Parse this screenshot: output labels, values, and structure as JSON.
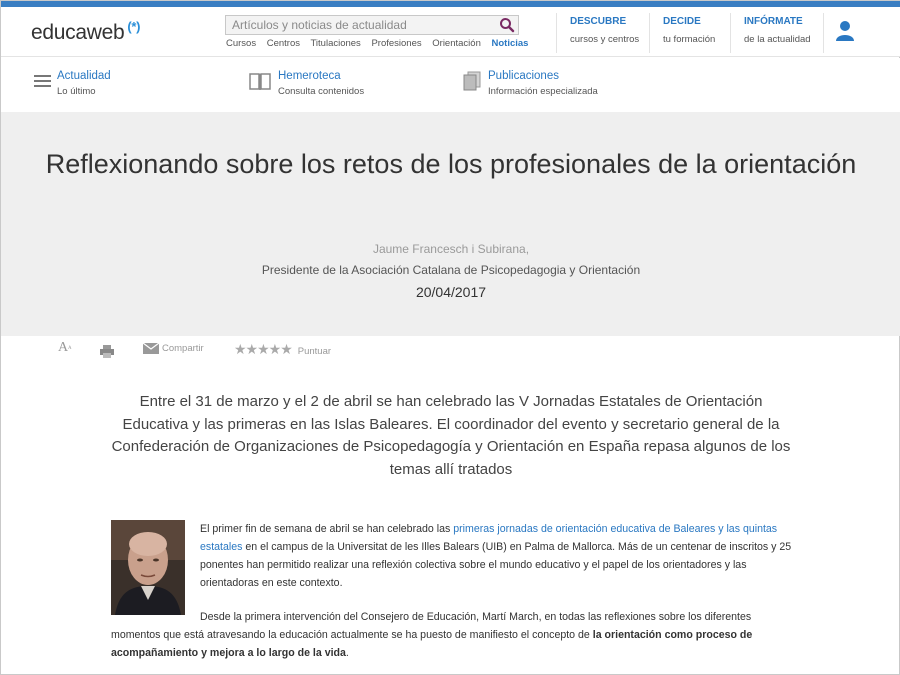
{
  "header": {
    "logo_text": "educaweb",
    "logo_mark": "(*)",
    "search_placeholder": "Artículos y noticias de actualidad",
    "top_links": [
      "Cursos",
      "Centros",
      "Titulaciones",
      "Profesiones",
      "Orientación",
      "Noticias"
    ],
    "active_link": "Noticias",
    "nav": [
      {
        "title": "DESCUBRE",
        "subtitle": "cursos y centros"
      },
      {
        "title": "DECIDE",
        "subtitle": "tu formación"
      },
      {
        "title": "INFÓRMATE",
        "subtitle": "de la actualidad"
      }
    ],
    "user_icon": "user-icon"
  },
  "subnav": [
    {
      "icon": "list-icon",
      "title": "Actualidad",
      "subtitle": "Lo último"
    },
    {
      "icon": "book-icon",
      "title": "Hemeroteca",
      "subtitle": "Consulta contenidos"
    },
    {
      "icon": "documents-icon",
      "title": "Publicaciones",
      "subtitle": "Información especializada"
    }
  ],
  "article": {
    "title": "Reflexionando sobre los retos de los profesionales de la orientación",
    "author": "Jaume Francesch i Subirana,",
    "role": "Presidente de la Asociación Catalana de Psicopedagogia y Orientación",
    "date": "20/04/2017",
    "tools": {
      "font_size": "A",
      "share_label": "Compartir",
      "rate_label": "Puntuar",
      "stars": "★★★★★"
    },
    "lead": "Entre el 31 de marzo y el 2 de abril se han celebrado las V Jornadas Estatales de Orientación Educativa y las primeras en las Islas Baleares. El coordinador del evento y secretario general de la Confederación de Organizaciones de Psicopedagogía y Orientación en España repasa algunos de los temas allí tratados",
    "p1_a": "El primer fin de semana de abril se han celebrado las ",
    "p1_link": "primeras jornadas de orientación educativa de Baleares y las quintas estatales",
    "p1_b": " en el campus de la Universitat de les Illes Balears (UIB) en Palma de Mallorca. Más de un centenar de inscritos y 25 ponentes han permitido realizar una reflexión colectiva sobre el mundo educativo y el papel de los orientadores y las orientadoras en este contexto.",
    "p2_a": "Desde la primera intervención del Consejero de Educación, Martí March, en todas las reflexiones sobre los diferentes momentos que está atravesando la educación actualmente se ha puesto de manifiesto el concepto de ",
    "p2_bold": "la orientación como proceso de acompañamiento y mejora a lo largo de la vida",
    "p2_end": "."
  }
}
